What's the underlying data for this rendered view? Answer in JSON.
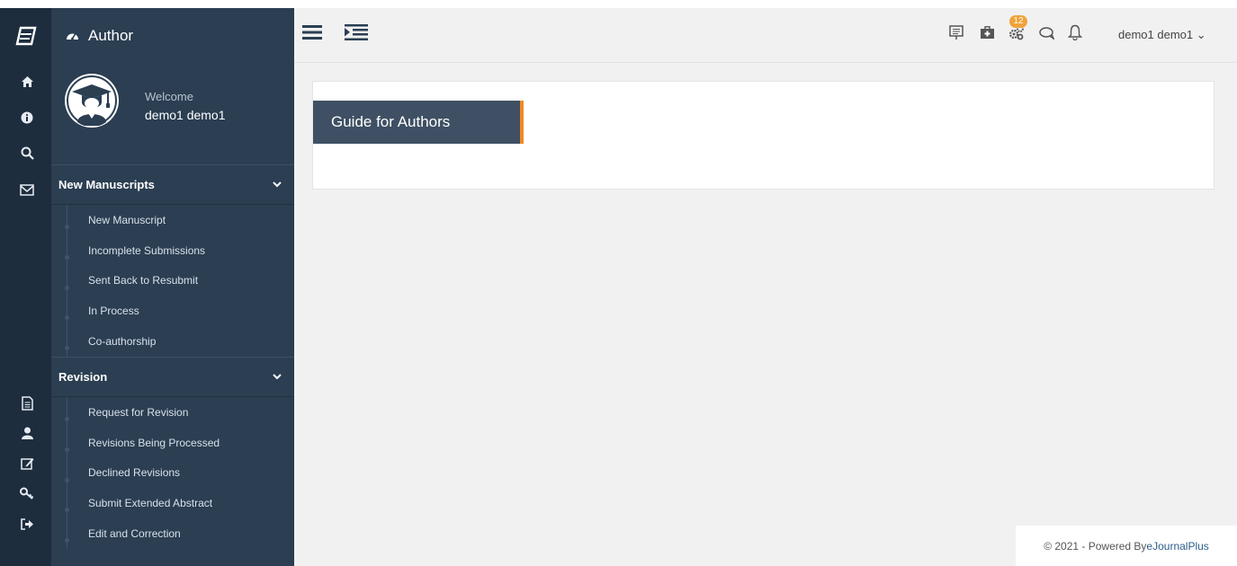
{
  "sidebar": {
    "title": "Author",
    "welcome": "Welcome",
    "user_name": "demo1 demo1",
    "sections": [
      {
        "title": "New Manuscripts",
        "items": [
          "New Manuscript",
          "Incomplete Submissions",
          "Sent Back to Resubmit",
          "In Process",
          "Co-authorship"
        ]
      },
      {
        "title": "Revision",
        "items": [
          "Request for Revision",
          "Revisions Being Processed",
          "Declined Revisions",
          "Submit Extended Abstract",
          "Edit and Correction"
        ]
      }
    ]
  },
  "iconbar": {
    "top_icons": [
      "home-icon",
      "info-icon",
      "search-icon",
      "mail-icon"
    ],
    "bottom_icons": [
      "document-icon",
      "user-icon",
      "edit-icon",
      "key-icon",
      "logout-icon"
    ]
  },
  "topbar": {
    "notification_count": "12",
    "user_menu": "demo1 demo1 ⌄",
    "icons": [
      "presentation-icon",
      "medical-kit-icon",
      "gears-icon",
      "chat-icon",
      "bell-icon"
    ]
  },
  "main": {
    "guide_tab": "Guide for Authors"
  },
  "footer": {
    "text": "© 2021 - Powered By ",
    "link": "eJournalPlus"
  },
  "colors": {
    "iconbar_bg": "#1e2d3e",
    "sidebar_bg": "#2b3e52",
    "accent": "#f08a24",
    "tab_bg": "#3f5064",
    "badge": "#f0a33b"
  }
}
